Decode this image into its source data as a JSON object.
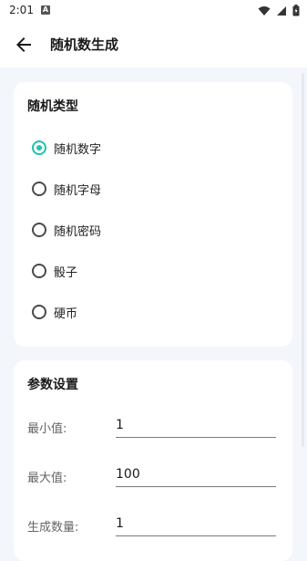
{
  "status_bar": {
    "time": "2:01",
    "notification_icon": "a-icon",
    "wifi_icon": "wifi-icon",
    "signal_icon": "signal-icon",
    "battery_icon": "battery-icon"
  },
  "app_bar": {
    "back_icon": "arrow-back-icon",
    "title": "随机数生成"
  },
  "type_card": {
    "title": "随机类型",
    "options": [
      {
        "label": "随机数字",
        "checked": true
      },
      {
        "label": "随机字母",
        "checked": false
      },
      {
        "label": "随机密码",
        "checked": false
      },
      {
        "label": "骰子",
        "checked": false
      },
      {
        "label": "硬币",
        "checked": false
      }
    ]
  },
  "params_card": {
    "title": "参数设置",
    "fields": [
      {
        "label": "最小值:",
        "value": "1"
      },
      {
        "label": "最大值:",
        "value": "100"
      },
      {
        "label": "生成数量:",
        "value": "1"
      }
    ]
  },
  "colors": {
    "accent": "#1dc3b0",
    "background": "#f3f6fb",
    "card": "#ffffff"
  }
}
